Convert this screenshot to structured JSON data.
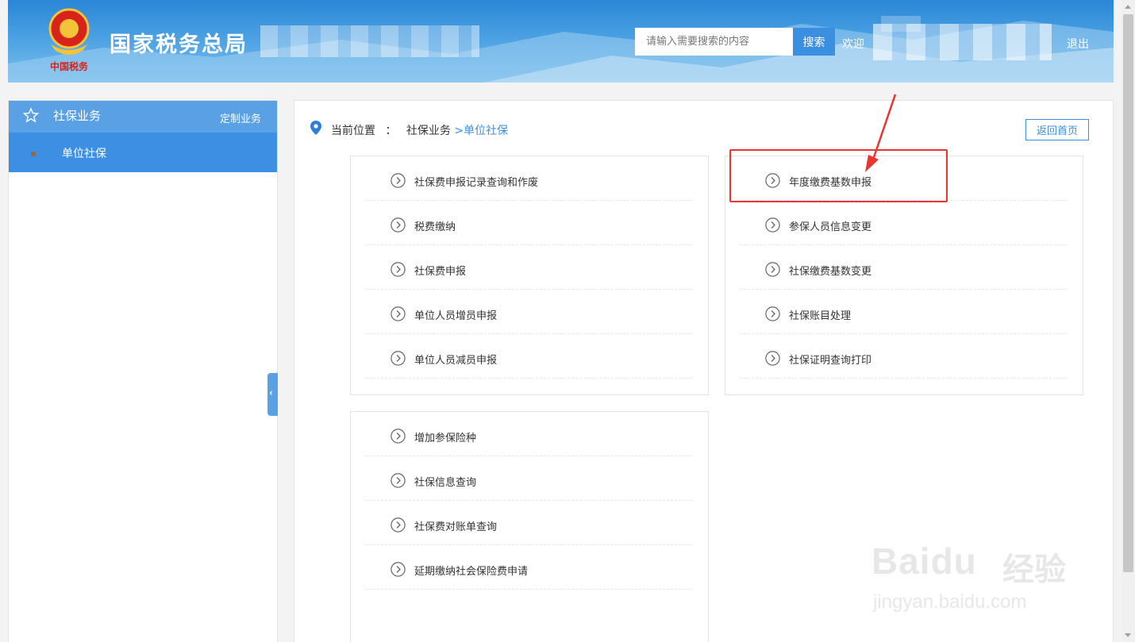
{
  "header": {
    "site_title": "国家税务总局",
    "search_placeholder": "请输入需要搜索的内容",
    "search_button": "搜索",
    "welcome": "欢迎",
    "logout": "退出",
    "logo_text": "中国税务"
  },
  "sidebar": {
    "title": "社保业务",
    "custom_label": "定制业务",
    "items": [
      {
        "label": "单位社保"
      }
    ]
  },
  "breadcrumb": {
    "prefix": "当前位置",
    "sep": "：",
    "level1": "社保业务",
    "current": ">单位社保"
  },
  "home_button": "返回首页",
  "panels": {
    "left_top": [
      "社保费申报记录查询和作废",
      "税费缴纳",
      "社保费申报",
      "单位人员增员申报",
      "单位人员减员申报"
    ],
    "right_top": [
      "年度缴费基数申报",
      "参保人员信息变更",
      "社保缴费基数变更",
      "社保账目处理",
      "社保证明查询打印"
    ],
    "left_bottom": [
      "增加参保险种",
      "社保信息查询",
      "社保费对账单查询",
      "延期缴纳社会保险费申请"
    ]
  },
  "watermark": {
    "brand": "Baidu",
    "brand_cn": "经验",
    "sub": "jingyan.baidu.com"
  },
  "colors": {
    "accent": "#3a8fe0",
    "highlight": "#e8352f"
  }
}
